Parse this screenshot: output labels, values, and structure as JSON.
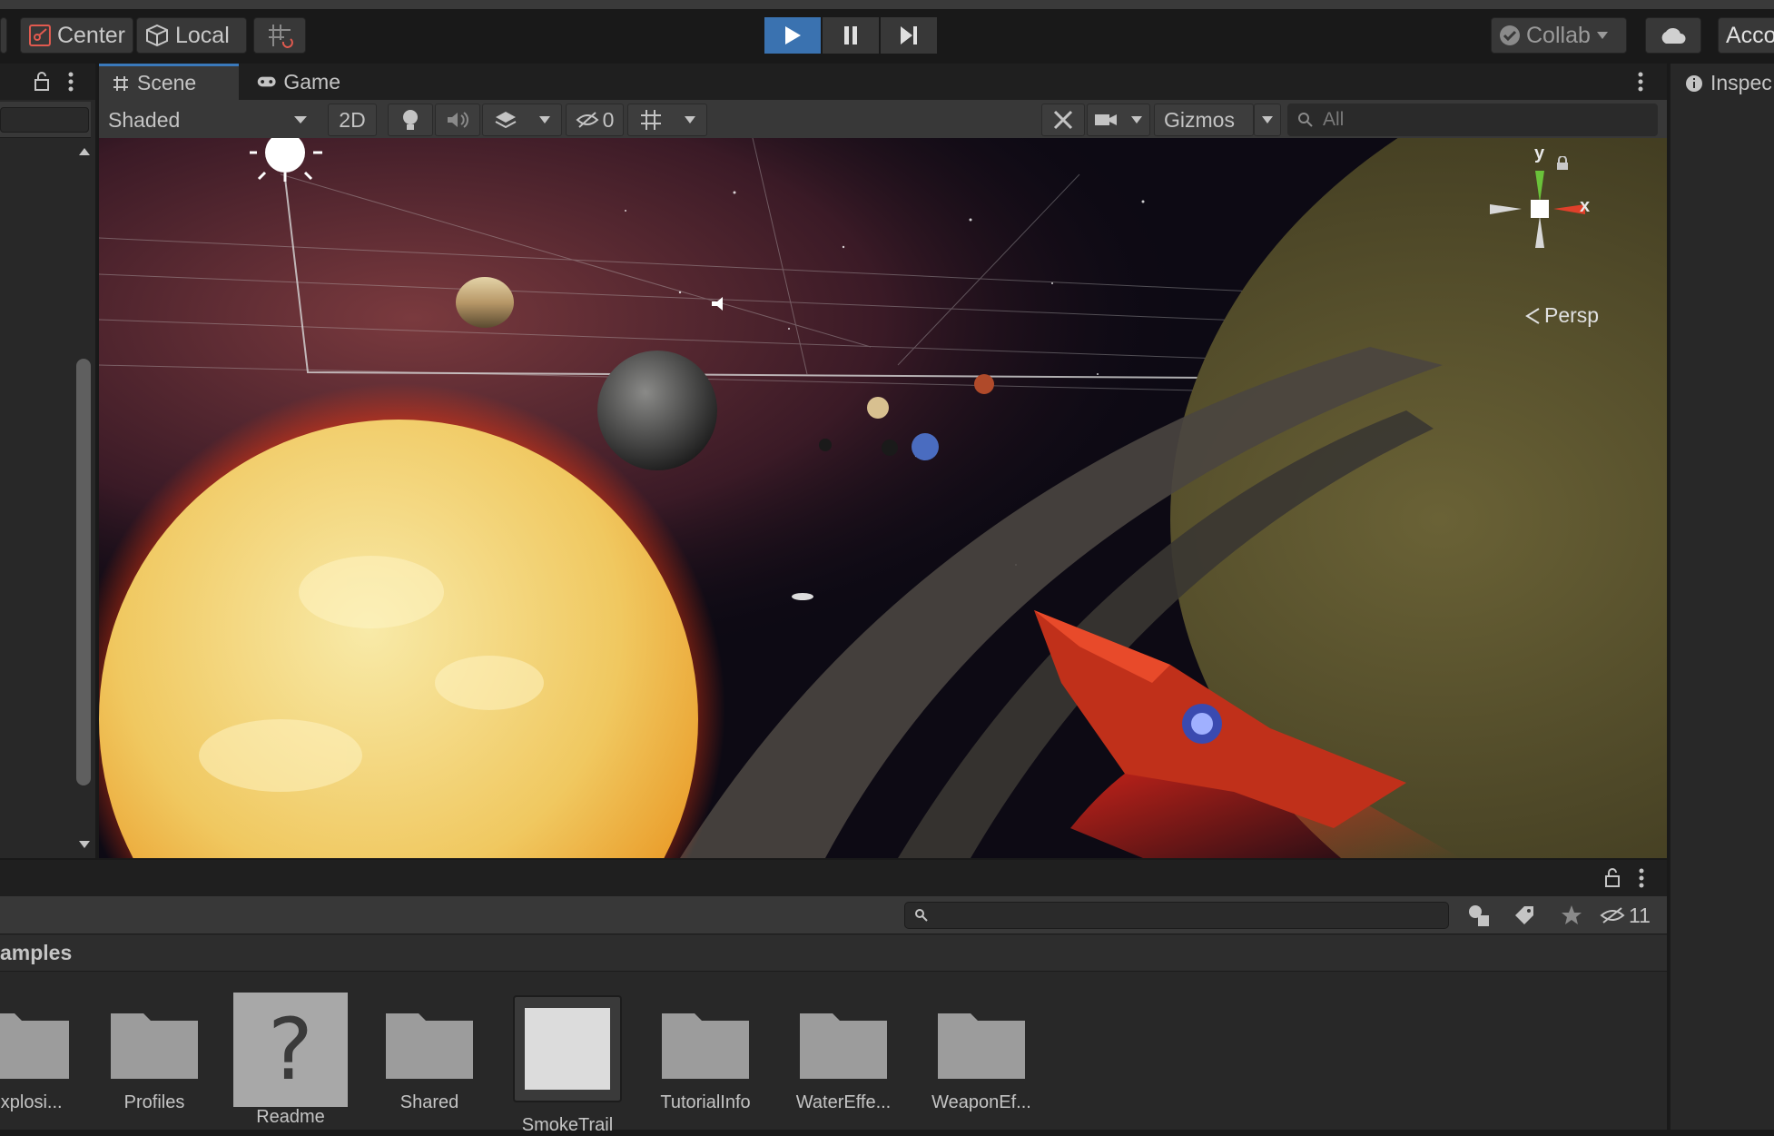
{
  "toolbar": {
    "pivot_label": "Center",
    "space_label": "Local",
    "collab_label": "Collab",
    "account_label": "Acco"
  },
  "scene_tabs": [
    {
      "label": "Scene"
    },
    {
      "label": "Game"
    }
  ],
  "scene_toolbar": {
    "draw_mode": "Shaded",
    "mode_2d": "2D",
    "hidden_count": "0",
    "gizmos_label": "Gizmos",
    "search_placeholder": "All"
  },
  "gizmo": {
    "x_label": "x",
    "y_label": "y",
    "projection_label": "Persp"
  },
  "inspector": {
    "tab_label": "Inspec"
  },
  "project": {
    "breadcrumb": "amples",
    "hidden_count": "11",
    "items": [
      {
        "label": "Explosi...",
        "icon": "folder-icon"
      },
      {
        "label": "Profiles",
        "icon": "folder-icon"
      },
      {
        "label": "Readme",
        "icon": "unknown-asset-icon"
      },
      {
        "label": "Shared",
        "icon": "folder-icon"
      },
      {
        "label": "SmokeTrail",
        "icon": "material-icon"
      },
      {
        "label": "TutorialInfo",
        "icon": "folder-icon"
      },
      {
        "label": "WaterEffe...",
        "icon": "folder-icon"
      },
      {
        "label": "WeaponEf...",
        "icon": "folder-icon"
      }
    ]
  },
  "colors": {
    "accent": "#3a79bb",
    "panel": "#282828",
    "toolbar": "#191919"
  }
}
